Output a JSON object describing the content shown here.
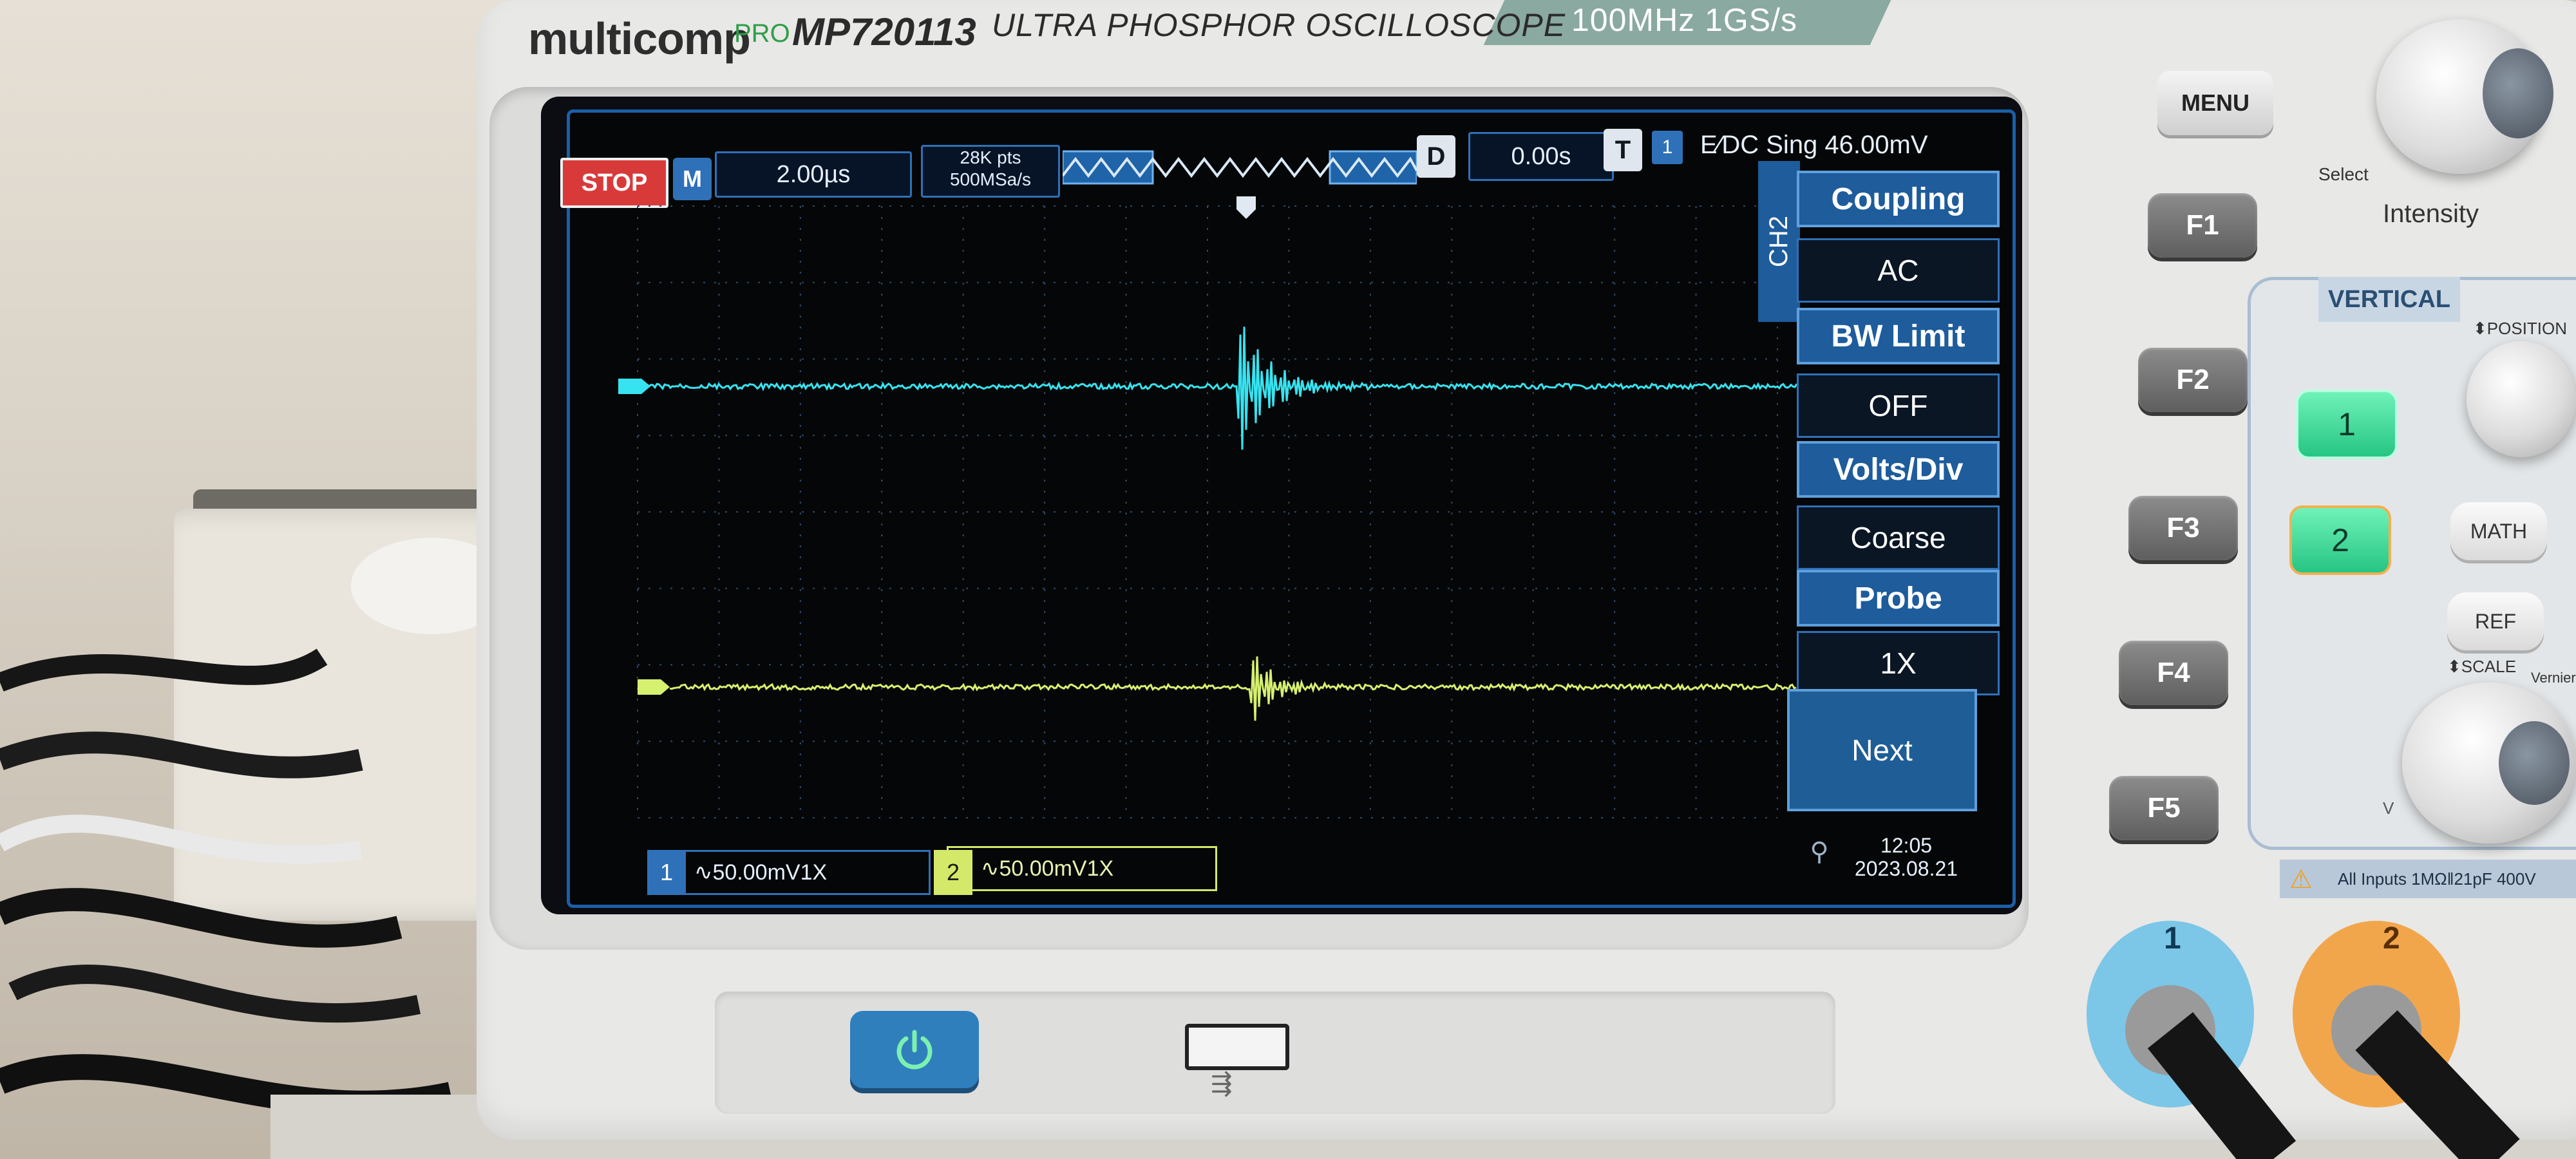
{
  "brand": {
    "logo": "multicomp",
    "pro": "PRO",
    "model": "MP720113",
    "subtitle": "ULTRA PHOSPHOR OSCILLOSCOPE",
    "spec": "100MHz 1GS/s"
  },
  "topbar": {
    "run_state": "STOP",
    "mode": "M",
    "timebase": "2.00µs",
    "points_line1": "28K pts",
    "points_line2": "500MSa/s",
    "d_label": "D",
    "delay": "0.00s",
    "t_label": "T",
    "trigger_channel": "1",
    "trigger_info": "E⁄DC Sing 46.00mV"
  },
  "side_menu": {
    "channel_tab": "CH2",
    "items": [
      {
        "label": "Coupling",
        "value": "AC"
      },
      {
        "label": "BW  Limit",
        "value": "OFF"
      },
      {
        "label": "Volts/Div",
        "value": "Coarse"
      },
      {
        "label": "Probe",
        "value": "1X"
      }
    ],
    "next_label": "Next"
  },
  "status": {
    "ch1_num": "1",
    "ch1_text": "∿50.00mV1X",
    "ch2_num": "2",
    "ch2_text": "∿50.00mV1X",
    "usb_symbol": "⚲",
    "time": "12:05",
    "date": "2023.08.21"
  },
  "buttons": {
    "menu": "MENU",
    "f1": "F1",
    "f2": "F2",
    "f3": "F3",
    "f4": "F4",
    "f5": "F5",
    "select": "Select",
    "intensity": "Intensity",
    "vertical": "VERTICAL",
    "position": "⬍POSITION",
    "ch1": "1",
    "ch2": "2",
    "math": "MATH",
    "ref": "REF",
    "scale": "⬍SCALE",
    "vernier": "Vernier",
    "v": "V",
    "all_inputs": "All Inputs  1MΩ‖21pF  400V",
    "bnc1": "1",
    "bnc2": "2"
  },
  "colors": {
    "ch1": "#37e3f0",
    "ch2": "#d6f070",
    "accent": "#2f71b8",
    "stop": "#d83a3a"
  }
}
